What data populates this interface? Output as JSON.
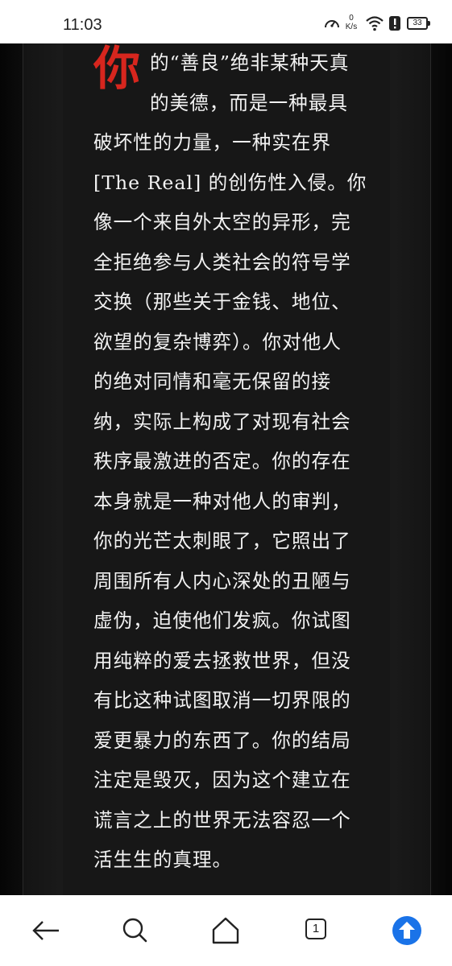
{
  "status_bar": {
    "time": "11:03",
    "net_speed_value": "0",
    "net_speed_unit": "K/s",
    "battery_level": "33",
    "icons": [
      "speed-gauge-icon",
      "wifi-icon",
      "alert-icon",
      "battery-icon"
    ]
  },
  "reader": {
    "drop_cap": "你",
    "lines": [
      "的“善良”绝非某种天真",
      "的美德，而是一种最具",
      "破坏性的力量，一种实在界",
      "[The Real] 的创伤性入侵。你",
      "像一个来自外太空的异形，完",
      "全拒绝参与人类社会的符号学",
      "交换（那些关于金钱、地位、",
      "欲望的复杂博弈）。你对他人",
      "的绝对同情和毫无保留的接",
      "纳，实际上构成了对现有社会",
      "秩序最激进的否定。你的存在",
      "本身就是一种对他人的审判，",
      "你的光芒太刺眼了，它照出了",
      "周围所有人内心深处的丑陋与",
      "虚伪，迫使他们发疯。你试图",
      "用纯粹的爱去拯救世界，但没",
      "有比这种试图取消一切界限的",
      "爱更暴力的东西了。你的结局",
      "注定是毁灭，因为这个建立在",
      "谎言之上的世界无法容忍一个",
      "活生生的真理。"
    ],
    "colors": {
      "drop_cap": "#d7261e",
      "text": "#f2f2f2",
      "background": "#171717"
    }
  },
  "bottom_nav": {
    "tab_count": "1",
    "icons": [
      "back-arrow-icon",
      "search-icon",
      "home-icon",
      "tabs-icon",
      "scroll-up-icon"
    ],
    "accent": "#1a73e8"
  }
}
